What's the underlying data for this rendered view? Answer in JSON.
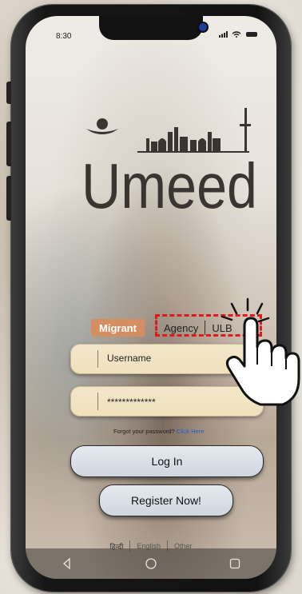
{
  "status": {
    "time": "8:30"
  },
  "app": {
    "logo_text": "Umeed"
  },
  "tabs": [
    {
      "label": "Migrant",
      "active": true
    },
    {
      "label": "Agency",
      "active": false
    },
    {
      "label": "ULB",
      "active": false
    }
  ],
  "form": {
    "username_placeholder": "Username",
    "password_value": "*************",
    "forgot_text": "Forgot your password?",
    "forgot_link": "Click Here",
    "login_label": "Log In",
    "register_label": "Register Now!"
  },
  "languages": [
    "हिन्दी",
    "English",
    "Other"
  ],
  "colors": {
    "active_tab": "#d58e62",
    "highlight": "#e01a1a",
    "link": "#1a63c9",
    "field_bg": "#f3e7c9"
  },
  "icons": [
    "back-icon",
    "home-icon",
    "recent-apps-icon",
    "pointing-hand-icon",
    "wifi-icon",
    "signal-icon",
    "battery-icon",
    "camera-icon"
  ]
}
